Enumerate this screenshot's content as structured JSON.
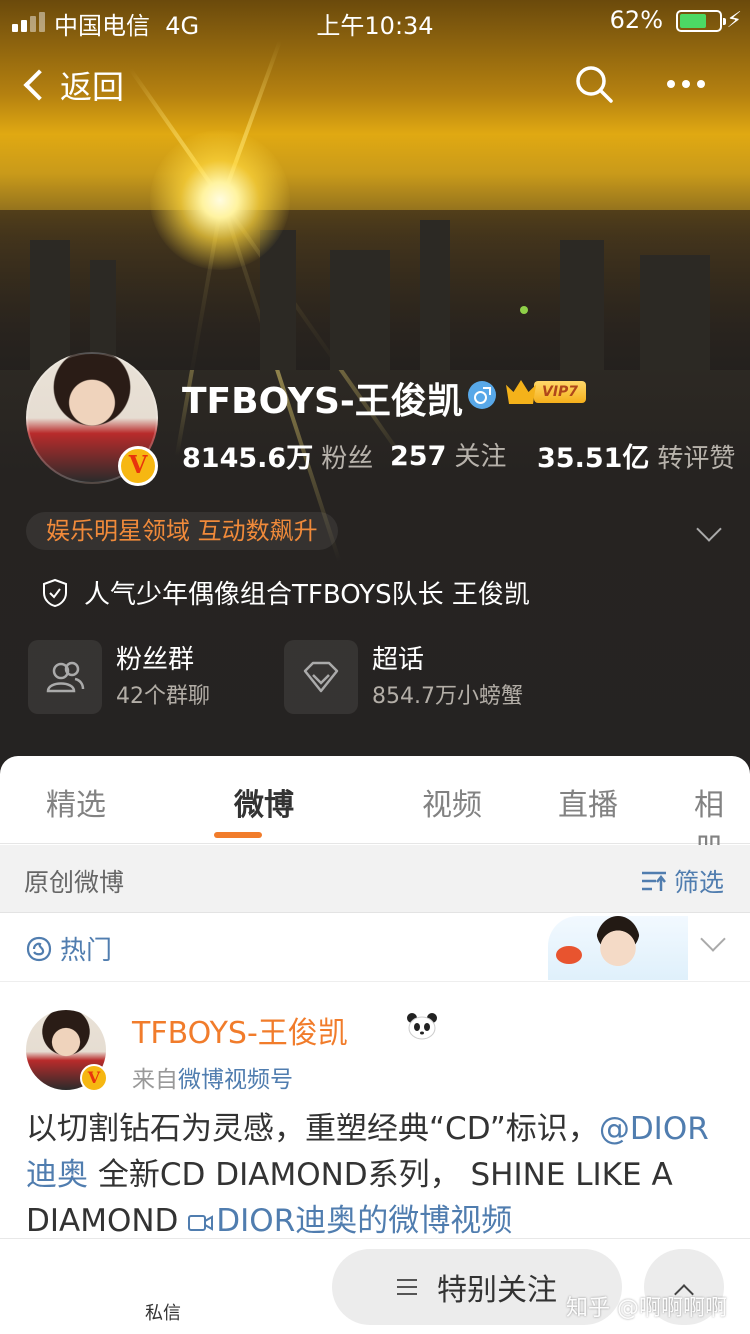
{
  "status_bar": {
    "carrier": "中国电信",
    "network": "4G",
    "time": "上午10:34",
    "battery": "62%"
  },
  "nav": {
    "back_label": "返回"
  },
  "profile": {
    "name": "TFBOYS-王俊凯",
    "vip_label": "VIP7",
    "stats": {
      "followers_value": "8145.6万",
      "followers_label": "粉丝",
      "following_value": "257",
      "following_label": "关注",
      "engagement_value": "35.51亿",
      "engagement_label": "转评赞"
    },
    "domain_tag": "娱乐明星领域 互动数飙升",
    "bio": "人气少年偶像组合TFBOYS队长 王俊凯",
    "features": [
      {
        "title": "粉丝群",
        "subtitle": "42个群聊"
      },
      {
        "title": "超话",
        "subtitle": "854.7万小螃蟹"
      }
    ]
  },
  "tabs": [
    "精选",
    "微博",
    "视频",
    "直播",
    "相册"
  ],
  "active_tab": "微博",
  "filter_bar": {
    "left_label": "原创微博",
    "filter_label": "筛选"
  },
  "hot_bar": {
    "label": "热门"
  },
  "post": {
    "author": "TFBOYS-王俊凯",
    "source_prefix": "来自",
    "source_link": "微博视频号",
    "text_1": "以切割钻石为灵感，重塑经典“CD”标识，",
    "mention": "@DIOR迪奥",
    "text_2": " 全新CD DIAMOND系列， SHINE LIKE A DIAMOND ",
    "video_link": "DIOR迪奥的微博视频"
  },
  "bottom_bar": {
    "dm_label": "私信",
    "follow_label": "特别关注"
  },
  "watermark": "知乎 @啊啊啊啊",
  "colors": {
    "accent_orange": "#f17c2b",
    "link_blue": "#507daf",
    "vip_gold": "#f6b712"
  }
}
